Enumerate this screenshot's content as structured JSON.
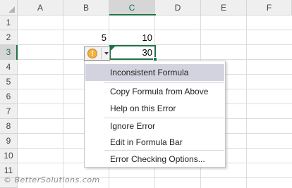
{
  "columns": [
    "A",
    "B",
    "C",
    "D",
    "E",
    "F"
  ],
  "selected_column": "C",
  "rows": [
    "1",
    "2",
    "3",
    "4",
    "5",
    "6",
    "7",
    "8",
    "9",
    "10",
    "11"
  ],
  "selected_row": "3",
  "cells": {
    "B2": "5",
    "C2": "10",
    "C3": "30"
  },
  "smart_tag": {
    "icon": "warning-icon",
    "glyph": "!"
  },
  "menu": {
    "items": [
      {
        "label": "Inconsistent Formula",
        "highlighted": true
      },
      {
        "label": "Copy Formula from Above"
      },
      {
        "label": "Help on this Error"
      },
      {
        "label": "Ignore Error"
      },
      {
        "label": "Edit in Formula Bar"
      },
      {
        "label": "Error Checking Options..."
      }
    ]
  },
  "watermark": "© BetterSolutions.com",
  "colors": {
    "accent": "#217346",
    "error_triangle": "#0a7c3c",
    "warning": "#f2b340"
  }
}
